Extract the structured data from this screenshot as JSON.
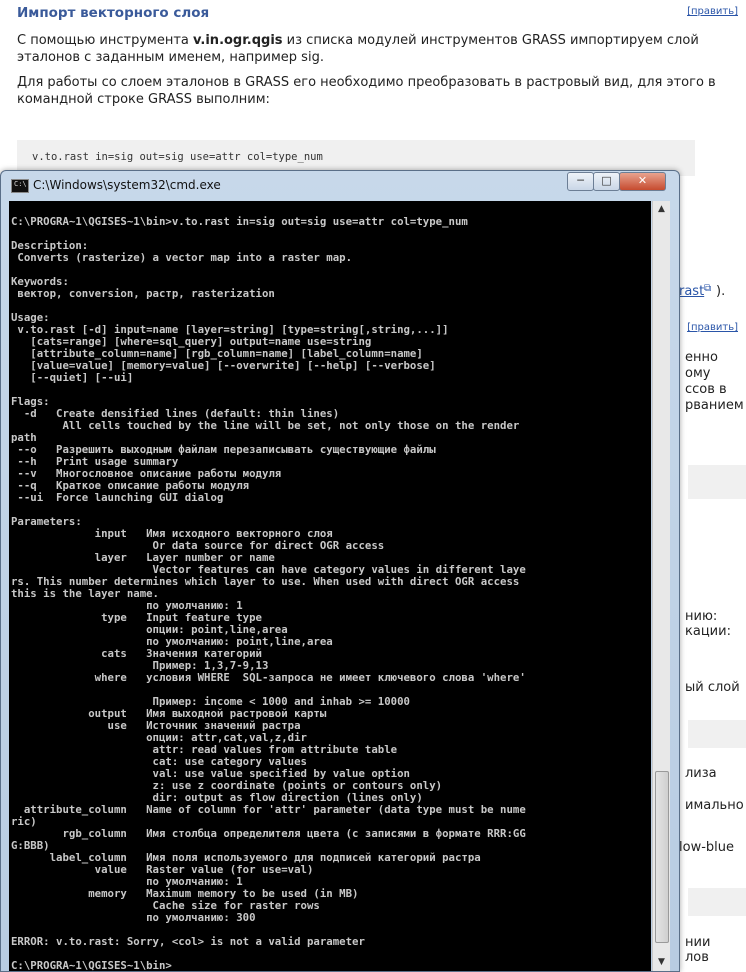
{
  "wiki": {
    "section_title": "Импорт векторного слоя",
    "edit_label": "[править]",
    "para1_pre": "С помощью инструмента ",
    "para1_bold": "v.in.ogr.qgis",
    "para1_post": " из списка модулей инструментов GRASS импортируем слой эталонов с заданным именем, например sig.",
    "para2": "Для работы со слоем эталонов в GRASS его необходимо преобразовать в растровый вид, для этого в командной строке GRASS выполним:",
    "code": "v.to.rast in=sig out=sig use=attr col=type_num",
    "fragments": {
      "rast_link": "rast",
      "rast_tail": ").",
      "edit2": "[править]",
      "f1": "енно",
      "f2": "ому",
      "f3": "ссов в",
      "f4": "рванием",
      "f5": "нию:",
      "f6": "кации:",
      "f7": "ый слой",
      "f8": "лиза",
      "f9": "имально",
      "f10": "low-blue",
      "f11": "нии",
      "f12": "лов"
    }
  },
  "window": {
    "title": "C:\\Windows\\system32\\cmd.exe",
    "min_label": "─",
    "max_label": "□",
    "close_label": "✕"
  },
  "console_lines": [
    "",
    "C:\\PROGRA~1\\QGISES~1\\bin>v.to.rast in=sig out=sig use=attr col=type_num",
    "",
    "Description:",
    " Converts (rasterize) a vector map into a raster map.",
    "",
    "Keywords:",
    " вектор, conversion, растр, rasterization",
    "",
    "Usage:",
    " v.to.rast [-d] input=name [layer=string] [type=string[,string,...]]",
    "   [cats=range] [where=sql_query] output=name use=string",
    "   [attribute_column=name] [rgb_column=name] [label_column=name]",
    "   [value=value] [memory=value] [--overwrite] [--help] [--verbose]",
    "   [--quiet] [--ui]",
    "",
    "Flags:",
    "  -d   Create densified lines (default: thin lines)",
    "        All cells touched by the line will be set, not only those on the render",
    "path",
    " --o   Разрешить выходным файлам перезаписывать существующие файлы",
    " --h   Print usage summary",
    " --v   Многословное описание работы модуля",
    " --q   Краткое описание работы модуля",
    " --ui  Force launching GUI dialog",
    "",
    "Parameters:",
    "             input   Имя исходного векторного слоя",
    "                      Or data source for direct OGR access",
    "             layer   Layer number or name",
    "                      Vector features can have category values in different laye",
    "rs. This number determines which layer to use. When used with direct OGR access",
    "this is the layer name.",
    "                     по умолчанию: 1",
    "              type   Input feature type",
    "                     опции: point,line,area",
    "                     по умолчанию: point,line,area",
    "              cats   Значения категорий",
    "                      Пример: 1,3,7-9,13",
    "             where   условия WHERE  SQL-запроса не имеет ключевого слова 'where'",
    "",
    "                      Пример: income < 1000 and inhab >= 10000",
    "            output   Имя выходной растровой карты",
    "               use   Источник значений растра",
    "                     опции: attr,cat,val,z,dir",
    "                      attr: read values from attribute table",
    "                      cat: use category values",
    "                      val: use value specified by value option",
    "                      z: use z coordinate (points or contours only)",
    "                      dir: output as flow direction (lines only)",
    "  attribute_column   Name of column for 'attr' parameter (data type must be nume",
    "ric)",
    "        rgb_column   Имя столбца определителя цвета (с записями в формате RRR:GG",
    "G:BBB)",
    "      label_column   Имя поля используемого для подписей категорий растра",
    "             value   Raster value (for use=val)",
    "                     по умолчанию: 1",
    "            memory   Maximum memory to be used (in MB)",
    "                      Cache size for raster rows",
    "                     по умолчанию: 300",
    "",
    "ERROR: v.to.rast: Sorry, <col> is not a valid parameter",
    "",
    "C:\\PROGRA~1\\QGISES~1\\bin>"
  ],
  "scrollbar": {
    "up_icon": "▲",
    "down_icon": "▼"
  }
}
